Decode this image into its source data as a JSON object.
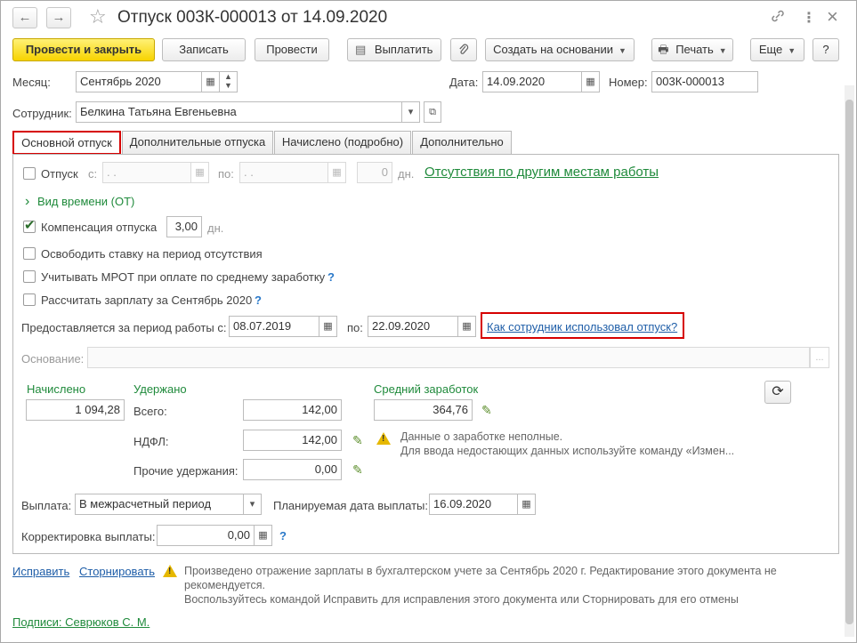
{
  "window": {
    "title": "Отпуск 003К-000013 от 14.09.2020"
  },
  "toolbar": {
    "post_close": "Провести и закрыть",
    "save": "Записать",
    "post": "Провести",
    "pay": "Выплатить",
    "create_based": "Создать на основании",
    "print": "Печать",
    "more": "Еще",
    "help": "?"
  },
  "header": {
    "month_label": "Месяц:",
    "month_value": "Сентябрь 2020",
    "date_label": "Дата:",
    "date_value": "14.09.2020",
    "number_label": "Номер:",
    "number_value": "003К-000013",
    "employee_label": "Сотрудник:",
    "employee_value": "Белкина Татьяна Евгеньевна"
  },
  "tabs": [
    "Основной отпуск",
    "Дополнительные отпуска",
    "Начислено (подробно)",
    "Дополнительно"
  ],
  "main": {
    "vacation_label": "Отпуск",
    "from_label": "с:",
    "from_value": ". .",
    "to_label": "по:",
    "to_value": ". .",
    "days_value": "0",
    "days_unit": "дн.",
    "other_absences_link": "Отсутствия по другим местам работы",
    "time_type": "Вид времени (ОТ)",
    "compensation_label": "Компенсация отпуска",
    "compensation_value": "3,00",
    "compensation_unit": "дн.",
    "release_rate": "Освободить ставку на период отсутствия",
    "consider_mrot": "Учитывать МРОТ при оплате по среднему заработку",
    "calc_salary": "Рассчитать зарплату за Сентябрь 2020",
    "period_label": "Предоставляется за период работы с:",
    "period_from": "08.07.2019",
    "period_to_label": "по:",
    "period_to": "22.09.2020",
    "usage_link": "Как сотрудник использовал отпуск?",
    "basis_label": "Основание:",
    "basis_value": "",
    "basis_btn": "...",
    "accrued_label": "Начислено",
    "accrued_value": "1 094,28",
    "withheld_label": "Удержано",
    "total_label": "Всего:",
    "total_value": "142,00",
    "ndfl_label": "НДФЛ:",
    "ndfl_value": "142,00",
    "other_withholdings_label": "Прочие удержания:",
    "other_withholdings_value": "0,00",
    "avg_earnings_label": "Средний заработок",
    "avg_earnings_value": "364,76",
    "warn_line1": "Данные о заработке неполные.",
    "warn_line2": "Для ввода недостающих данных используйте команду «Измен...",
    "payment_label": "Выплата:",
    "payment_value": "В межрасчетный период",
    "planned_date_label": "Планируемая дата выплаты:",
    "planned_date_value": "16.09.2020",
    "correction_label": "Корректировка выплаты:",
    "correction_value": "0,00",
    "q": "?"
  },
  "footer": {
    "fix_link": "Исправить",
    "reverse_link": "Сторнировать",
    "msg_line1": "Произведено отражение зарплаты в бухгалтерском учете за Сентябрь 2020 г. Редактирование этого документа не",
    "msg_line2": "рекомендуется.",
    "msg_line3": "Воспользуйтесь командой Исправить для исправления этого документа или Сторнировать для его отмены",
    "signatures_link": "Подписи: Севрюков С. М."
  },
  "icons": {
    "back": "←",
    "forward": "→",
    "star": "☆",
    "link": "🔗",
    "menu": "⋮",
    "close": "×",
    "pay": "▤",
    "clip": "📎",
    "printer": "🖶",
    "calendar": "▦",
    "dropdown": "▾",
    "open": "⧉",
    "chevron": "›",
    "pencil": "✎",
    "refresh": "⟳",
    "spin": "⇕"
  },
  "colors": {
    "accent_yellow": "#f7d300",
    "highlight_red": "#d60000",
    "link_green": "#1f8a3b",
    "link_blue": "#1f5ea8"
  }
}
